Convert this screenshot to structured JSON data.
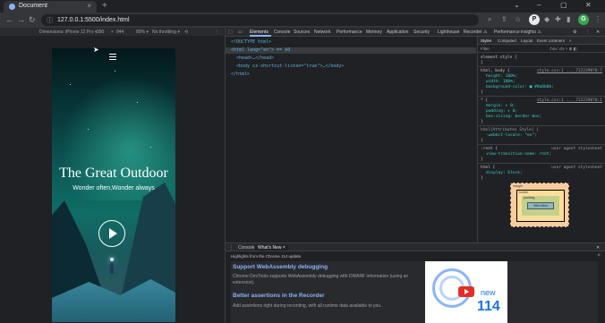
{
  "browser": {
    "tab_title": "Document",
    "url": "127.0.0.1:5500/index.html",
    "new_tab_symbol": "+",
    "profile_initial": "G",
    "avatar_initial": "P"
  },
  "device_toolbar": {
    "dimensions_label": "Dimensions: iPhone 12 Pro ▾",
    "width": "390",
    "x": "×",
    "height": "844",
    "zoom": "80% ▾",
    "throttling": "No throttling ▾"
  },
  "page": {
    "hero_title": "The Great Outdoor",
    "hero_subtitle": "Wonder often,Wonder always"
  },
  "devtools": {
    "tabs": [
      "Elements",
      "Console",
      "Sources",
      "Network",
      "Performance",
      "Memory",
      "Application",
      "Security",
      "Lighthouse",
      "Recorder ⚠",
      "Performance insights ⚠"
    ],
    "active_tab": "Elements",
    "elements": {
      "doctype": "<!DOCTYPE html>",
      "html_open": "<html lang=\"en\"> == $0",
      "head": "<head>…</head>",
      "body": "<body cz-shortcut-listen=\"true\">…</body>",
      "html_close": "</html>"
    },
    "breadcrumb": "html",
    "styles_tabs": [
      "Styles",
      "Computed",
      "Layout",
      "Event Listeners",
      "»"
    ],
    "filter_placeholder": "Filter",
    "filter_buttons": ":hov .cls + ⊞ ◧",
    "styles": {
      "element_style": "element.style {",
      "element_close": "}",
      "html_selector": "html, body {",
      "html_src": "style.css:1 ..._712239070:7",
      "html_props": [
        "height: 100%;",
        "width: 100%;",
        "background-color: ■ #0a0b0b;"
      ],
      "star_selector": "* {",
      "star_src": "style.css:1 ..._712239070:1",
      "star_props": [
        "margin: ▸ 0;",
        "padding: ▸ 0;",
        "box-sizing: border-box;"
      ],
      "html_attr": "html[Attributes Style] {",
      "html_attr_prop": "-webkit-locale: \"en\";",
      "root_selector": ":root {",
      "root_src": "user agent stylesheet",
      "root_prop": "view-transition-name: root;",
      "html2_selector": "html {",
      "html2_src": "user agent stylesheet",
      "html2_prop": "display: block;"
    },
    "box_model": {
      "margin_label": "margin",
      "border_label": "border",
      "padding_label": "padding",
      "content": "390×2844"
    },
    "drawer": {
      "tabs": [
        "⋮",
        "Console",
        "What's New ×"
      ],
      "highlights": "Highlights from the Chrome 114 update",
      "close": "×",
      "headline1": "Support WebAssembly debugging",
      "body1": "Chrome DevTools supports WebAssembly debugging with DWARF information (using an extension).",
      "headline2": "Better assertions in the Recorder",
      "body2": "Add assertions right during recording, with all runtime data available to you.",
      "video_new": "new",
      "video_number": "114"
    }
  }
}
